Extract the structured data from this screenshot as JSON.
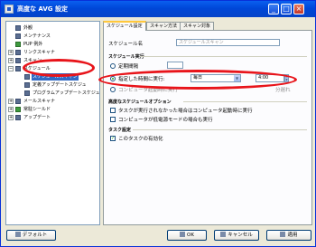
{
  "window": {
    "title": "高度な AVG 設定",
    "minimize_glyph": "_",
    "maximize_glyph": "□",
    "close_glyph": "×"
  },
  "tree": {
    "items": [
      {
        "label": "外観",
        "icon": "monitor-icon",
        "expander": ""
      },
      {
        "label": "メンテナンス",
        "icon": "gear-icon",
        "expander": ""
      },
      {
        "label": "PUP 例外",
        "icon": "shield-icon",
        "expander": ""
      },
      {
        "label": "リンクスキャナ",
        "icon": "link-icon",
        "expander": "+"
      },
      {
        "label": "スキャン",
        "icon": "scan-icon",
        "expander": "+"
      },
      {
        "label": "スケジュール",
        "icon": "calendar-icon",
        "expander": "−"
      },
      {
        "label": "スケジュールスキャン",
        "icon": "clock-icon",
        "expander": "",
        "selected": true
      },
      {
        "label": "定義アップデートスケジュ",
        "icon": "clock-icon",
        "expander": ""
      },
      {
        "label": "プログラムアップデートスケジュ",
        "icon": "clock-icon",
        "expander": ""
      },
      {
        "label": "メールスキャナ",
        "icon": "mail-icon",
        "expander": "+"
      },
      {
        "label": "常駐シールド",
        "icon": "shield-icon",
        "expander": "+"
      },
      {
        "label": "アップデート",
        "icon": "update-icon",
        "expander": "+"
      }
    ]
  },
  "tabs": [
    {
      "label": "スケジュール設定",
      "active": true
    },
    {
      "label": "スキャン方法",
      "active": false
    },
    {
      "label": "スキャン対象",
      "active": false
    }
  ],
  "form": {
    "schedule_name_label": "スケジュール名",
    "schedule_name_placeholder": "スケジュールスキャン",
    "run_section_header": "スケジュール実行",
    "interval_label": "定期間隔",
    "interval_value": "",
    "specific_time_label": "指定した時間に実行:",
    "day_value": "毎日",
    "time_value": "4:00",
    "on_startup_label": "コンピュータ起動時に実行",
    "delay_unit": "分遅れ",
    "advanced_header": "高度なスケジュールオプション",
    "missed_task_label": "タスクが実行されなかった場合はコンピュータ起動時に実行",
    "low_power_label": "コンピュータが低電源モードの場合も実行",
    "task_settings_header": "タスク設定",
    "enable_task_label": "このタスクの有効化"
  },
  "buttons": {
    "default": "デフォルト",
    "ok": "OK",
    "cancel": "キャンセル",
    "apply": "適用"
  },
  "colors": {
    "titlebar": "#0A5FEF",
    "selection": "#316AC5",
    "highlight_ellipse": "#E8141A",
    "radio_dot": "#21A121"
  }
}
